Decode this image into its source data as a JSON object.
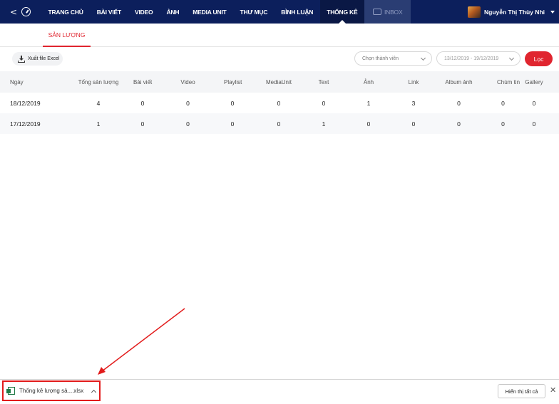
{
  "nav": {
    "items": [
      {
        "label": "TRANG CHỦ"
      },
      {
        "label": "BÀI VIẾT"
      },
      {
        "label": "VIDEO"
      },
      {
        "label": "ẢNH"
      },
      {
        "label": "MEDIA UNIT"
      },
      {
        "label": "THƯ MỤC"
      },
      {
        "label": "BÌNH LUẬN"
      },
      {
        "label": "THỐNG KÊ"
      }
    ],
    "active_index": 7,
    "inbox_label": "INBOX",
    "user_name": "Nguyễn Thị Thùy Nhi"
  },
  "subtab": {
    "label": "SẢN LƯỢNG"
  },
  "toolbar": {
    "export_label": "Xuất file Excel",
    "member_select_value": "Chọn thành viên",
    "date_range_value": "13/12/2019 - 19/12/2019",
    "filter_label": "Lọc"
  },
  "table": {
    "headers": [
      "Ngày",
      "Tổng sản lượng",
      "Bài viết",
      "Video",
      "Playlist",
      "MediaUnit",
      "Text",
      "Ảnh",
      "Link",
      "Album ảnh",
      "Chùm tin",
      "Gallery"
    ],
    "rows": [
      [
        "18/12/2019",
        "4",
        "0",
        "0",
        "0",
        "0",
        "0",
        "1",
        "3",
        "0",
        "0",
        "0"
      ],
      [
        "17/12/2019",
        "1",
        "0",
        "0",
        "0",
        "0",
        "1",
        "0",
        "0",
        "0",
        "0",
        "0"
      ]
    ]
  },
  "downloads": {
    "file_name": "Thống kê lượng sả....xlsx",
    "show_all_label": "Hiển thị tất cả",
    "close_symbol": "✕"
  },
  "colors": {
    "nav_bg": "#0c1f5c",
    "accent_red": "#e0252f",
    "annotation_red": "#e21b1b"
  }
}
